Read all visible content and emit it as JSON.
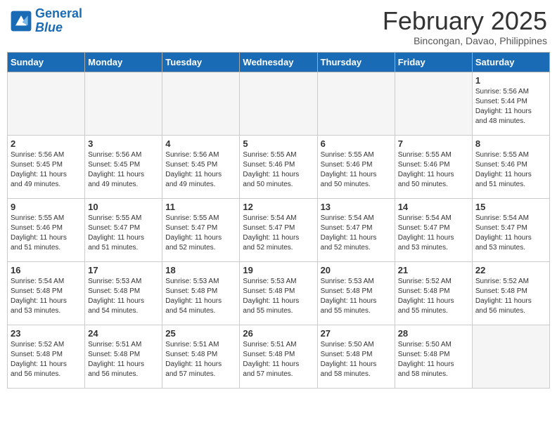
{
  "header": {
    "logo_line1": "General",
    "logo_line2": "Blue",
    "month": "February 2025",
    "location": "Bincongan, Davao, Philippines"
  },
  "weekdays": [
    "Sunday",
    "Monday",
    "Tuesday",
    "Wednesday",
    "Thursday",
    "Friday",
    "Saturday"
  ],
  "weeks": [
    [
      {
        "day": "",
        "info": ""
      },
      {
        "day": "",
        "info": ""
      },
      {
        "day": "",
        "info": ""
      },
      {
        "day": "",
        "info": ""
      },
      {
        "day": "",
        "info": ""
      },
      {
        "day": "",
        "info": ""
      },
      {
        "day": "1",
        "info": "Sunrise: 5:56 AM\nSunset: 5:44 PM\nDaylight: 11 hours\nand 48 minutes."
      }
    ],
    [
      {
        "day": "2",
        "info": "Sunrise: 5:56 AM\nSunset: 5:45 PM\nDaylight: 11 hours\nand 49 minutes."
      },
      {
        "day": "3",
        "info": "Sunrise: 5:56 AM\nSunset: 5:45 PM\nDaylight: 11 hours\nand 49 minutes."
      },
      {
        "day": "4",
        "info": "Sunrise: 5:56 AM\nSunset: 5:45 PM\nDaylight: 11 hours\nand 49 minutes."
      },
      {
        "day": "5",
        "info": "Sunrise: 5:55 AM\nSunset: 5:46 PM\nDaylight: 11 hours\nand 50 minutes."
      },
      {
        "day": "6",
        "info": "Sunrise: 5:55 AM\nSunset: 5:46 PM\nDaylight: 11 hours\nand 50 minutes."
      },
      {
        "day": "7",
        "info": "Sunrise: 5:55 AM\nSunset: 5:46 PM\nDaylight: 11 hours\nand 50 minutes."
      },
      {
        "day": "8",
        "info": "Sunrise: 5:55 AM\nSunset: 5:46 PM\nDaylight: 11 hours\nand 51 minutes."
      }
    ],
    [
      {
        "day": "9",
        "info": "Sunrise: 5:55 AM\nSunset: 5:46 PM\nDaylight: 11 hours\nand 51 minutes."
      },
      {
        "day": "10",
        "info": "Sunrise: 5:55 AM\nSunset: 5:47 PM\nDaylight: 11 hours\nand 51 minutes."
      },
      {
        "day": "11",
        "info": "Sunrise: 5:55 AM\nSunset: 5:47 PM\nDaylight: 11 hours\nand 52 minutes."
      },
      {
        "day": "12",
        "info": "Sunrise: 5:54 AM\nSunset: 5:47 PM\nDaylight: 11 hours\nand 52 minutes."
      },
      {
        "day": "13",
        "info": "Sunrise: 5:54 AM\nSunset: 5:47 PM\nDaylight: 11 hours\nand 52 minutes."
      },
      {
        "day": "14",
        "info": "Sunrise: 5:54 AM\nSunset: 5:47 PM\nDaylight: 11 hours\nand 53 minutes."
      },
      {
        "day": "15",
        "info": "Sunrise: 5:54 AM\nSunset: 5:47 PM\nDaylight: 11 hours\nand 53 minutes."
      }
    ],
    [
      {
        "day": "16",
        "info": "Sunrise: 5:54 AM\nSunset: 5:48 PM\nDaylight: 11 hours\nand 53 minutes."
      },
      {
        "day": "17",
        "info": "Sunrise: 5:53 AM\nSunset: 5:48 PM\nDaylight: 11 hours\nand 54 minutes."
      },
      {
        "day": "18",
        "info": "Sunrise: 5:53 AM\nSunset: 5:48 PM\nDaylight: 11 hours\nand 54 minutes."
      },
      {
        "day": "19",
        "info": "Sunrise: 5:53 AM\nSunset: 5:48 PM\nDaylight: 11 hours\nand 55 minutes."
      },
      {
        "day": "20",
        "info": "Sunrise: 5:53 AM\nSunset: 5:48 PM\nDaylight: 11 hours\nand 55 minutes."
      },
      {
        "day": "21",
        "info": "Sunrise: 5:52 AM\nSunset: 5:48 PM\nDaylight: 11 hours\nand 55 minutes."
      },
      {
        "day": "22",
        "info": "Sunrise: 5:52 AM\nSunset: 5:48 PM\nDaylight: 11 hours\nand 56 minutes."
      }
    ],
    [
      {
        "day": "23",
        "info": "Sunrise: 5:52 AM\nSunset: 5:48 PM\nDaylight: 11 hours\nand 56 minutes."
      },
      {
        "day": "24",
        "info": "Sunrise: 5:51 AM\nSunset: 5:48 PM\nDaylight: 11 hours\nand 56 minutes."
      },
      {
        "day": "25",
        "info": "Sunrise: 5:51 AM\nSunset: 5:48 PM\nDaylight: 11 hours\nand 57 minutes."
      },
      {
        "day": "26",
        "info": "Sunrise: 5:51 AM\nSunset: 5:48 PM\nDaylight: 11 hours\nand 57 minutes."
      },
      {
        "day": "27",
        "info": "Sunrise: 5:50 AM\nSunset: 5:48 PM\nDaylight: 11 hours\nand 58 minutes."
      },
      {
        "day": "28",
        "info": "Sunrise: 5:50 AM\nSunset: 5:48 PM\nDaylight: 11 hours\nand 58 minutes."
      },
      {
        "day": "",
        "info": ""
      }
    ]
  ]
}
